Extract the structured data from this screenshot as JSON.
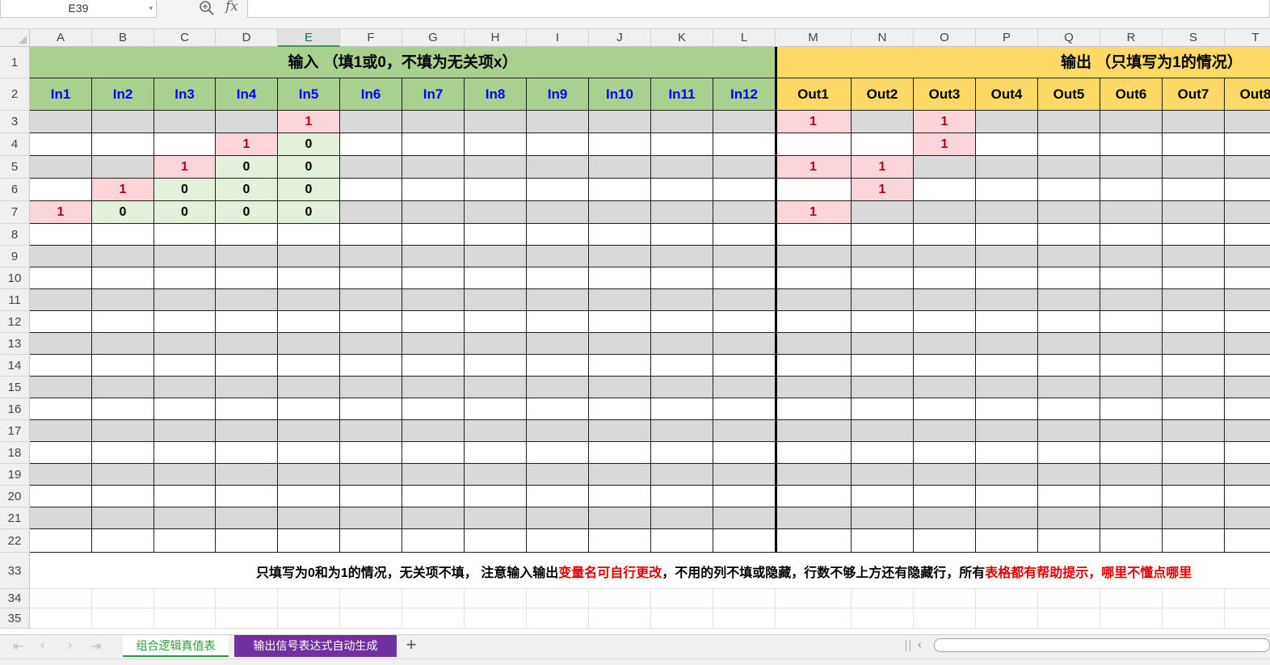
{
  "formula_bar": {
    "name_box": "E39",
    "fx_symbol": "fx",
    "formula": ""
  },
  "columns": [
    {
      "label": "A",
      "w": 77
    },
    {
      "label": "B",
      "w": 77
    },
    {
      "label": "C",
      "w": 76
    },
    {
      "label": "D",
      "w": 77
    },
    {
      "label": "E",
      "w": 77
    },
    {
      "label": "F",
      "w": 77
    },
    {
      "label": "G",
      "w": 77
    },
    {
      "label": "H",
      "w": 77
    },
    {
      "label": "I",
      "w": 77
    },
    {
      "label": "J",
      "w": 77
    },
    {
      "label": "K",
      "w": 77
    },
    {
      "label": "L",
      "w": 77
    },
    {
      "label": "M",
      "w": 94
    },
    {
      "label": "N",
      "w": 77
    },
    {
      "label": "O",
      "w": 77
    },
    {
      "label": "P",
      "w": 77
    },
    {
      "label": "Q",
      "w": 77
    },
    {
      "label": "R",
      "w": 77
    },
    {
      "label": "S",
      "w": 77
    },
    {
      "label": "T",
      "w": 77
    }
  ],
  "selected_column": "E",
  "row_numbers": [
    "1",
    "2",
    "3",
    "4",
    "5",
    "6",
    "7",
    "8",
    "9",
    "10",
    "11",
    "12",
    "13",
    "14",
    "15",
    "16",
    "17",
    "18",
    "19",
    "20",
    "21",
    "22",
    "33",
    "34",
    "35"
  ],
  "banners": {
    "input": "输入 （填1或0，不填为无关项x）",
    "output": "输出 （只填写为1的情况）"
  },
  "input_headers": [
    "In1",
    "In2",
    "In3",
    "In4",
    "In5",
    "In6",
    "In7",
    "In8",
    "In9",
    "In10",
    "In11",
    "In12"
  ],
  "output_headers": [
    "Out1",
    "Out2",
    "Out3",
    "Out4",
    "Out5",
    "Out6",
    "Out7",
    "Out8"
  ],
  "input_values": [
    [
      "",
      "",
      "",
      "",
      "1"
    ],
    [
      "",
      "",
      "",
      "1",
      "0"
    ],
    [
      "",
      "",
      "1",
      "0",
      "0"
    ],
    [
      "",
      "1",
      "0",
      "0",
      "0"
    ],
    [
      "1",
      "0",
      "0",
      "0",
      "0"
    ]
  ],
  "output_values": [
    [
      "1",
      "",
      "1"
    ],
    [
      "",
      "",
      "1"
    ],
    [
      "1",
      "1",
      ""
    ],
    [
      "",
      "1",
      ""
    ],
    [
      "1",
      "",
      ""
    ]
  ],
  "note": {
    "part1": "只填写为0和为1的情况，无关项不填， 注意输入输出",
    "part2": "变量名可自行更改",
    "part3": "，不用的列不填或隐藏，行数不够上方还有隐藏行，所有",
    "part4": "表格都有帮助提示，哪里不懂点哪里"
  },
  "sheet_tabs": {
    "tab1": "组合逻辑真值表",
    "tab2": "输出信号表达式自动生成",
    "add": "+"
  },
  "nav_buttons": [
    "|<",
    "<",
    ">",
    ">|"
  ]
}
